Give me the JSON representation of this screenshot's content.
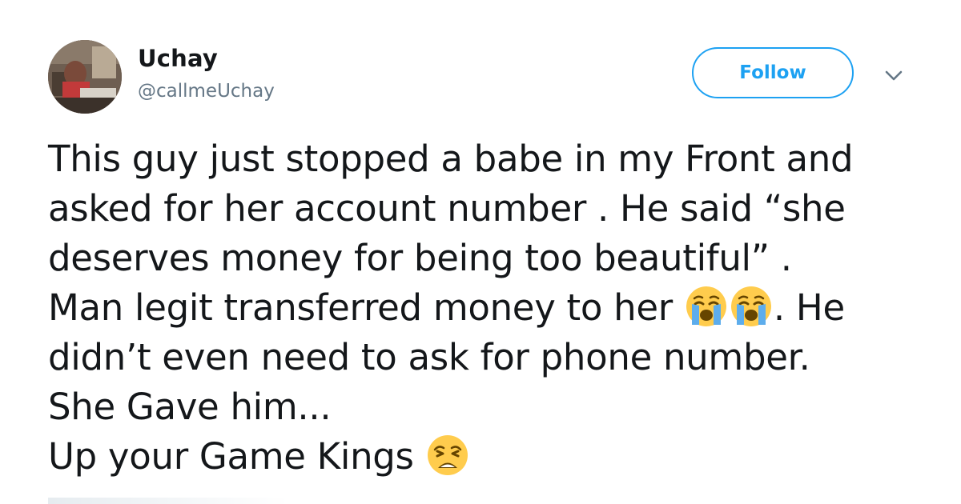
{
  "user": {
    "display_name": "Uchay",
    "handle": "@callmeUchay",
    "avatar_icon": "profile-photo"
  },
  "actions": {
    "follow_label": "Follow",
    "menu_icon": "chevron-down-icon"
  },
  "tweet": {
    "line1": "This guy just stopped a babe in my Front and",
    "line2": "asked for her account number . He said “she",
    "line3": "deserves money for being too beautiful” .",
    "line4a": "Man legit transferred money to her ",
    "line4b": ". He",
    "line5": "didn’t even need to ask for phone number.",
    "line6": "She Gave him...",
    "line7": "Up your Game Kings ",
    "emojis": [
      "crying-face-emoji",
      "crying-face-emoji",
      "weary-face-emoji"
    ]
  },
  "colors": {
    "accent": "#1da1f2",
    "text": "#14171a",
    "secondary": "#657786"
  }
}
